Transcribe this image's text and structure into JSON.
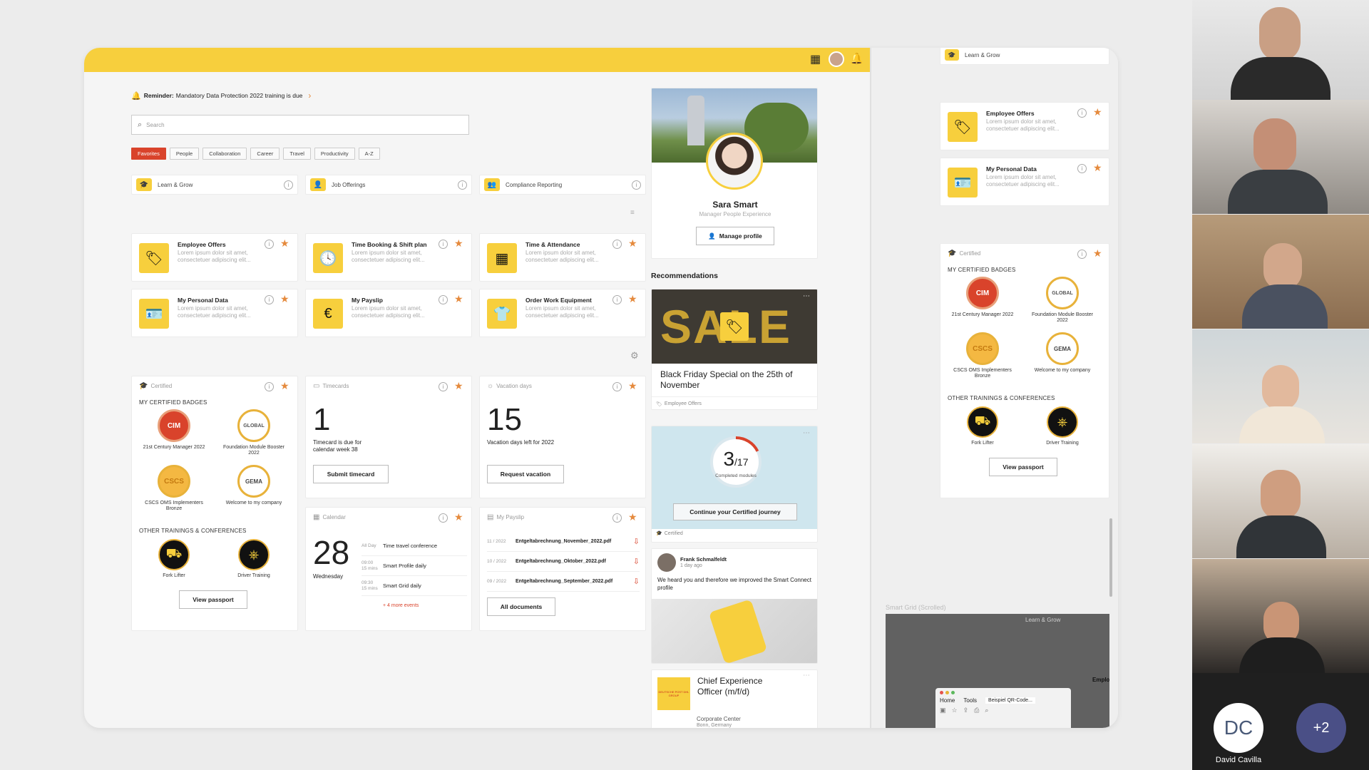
{
  "topbar": {
    "grid_icon": "grid-icon",
    "avatar": "avatar",
    "bell_icon": "bell-icon"
  },
  "reminder": {
    "label": "Reminder:",
    "text": "Mandatory Data Protection 2022 training is due"
  },
  "search": {
    "placeholder": "Search"
  },
  "tabs": [
    "Favorites",
    "People",
    "Collaboration",
    "Career",
    "Travel",
    "Productivity",
    "A-Z"
  ],
  "quicklinks": [
    "Learn & Grow",
    "Job Offerings",
    "Compliance Reporting"
  ],
  "apps": [
    {
      "title": "Employee Offers",
      "desc": "Lorem ipsum dolor sit amet, consectetuer adipiscing elit...",
      "icon": "tag-icon"
    },
    {
      "title": "Time Booking & Shift plan",
      "desc": "Lorem ipsum dolor sit amet, consectetuer adipiscing elit...",
      "icon": "clock-icon"
    },
    {
      "title": "Time & Attendance",
      "desc": "Lorem ipsum dolor sit amet, consectetuer adipiscing elit...",
      "icon": "calendar-grid-icon"
    },
    {
      "title": "My Personal Data",
      "desc": "Lorem ipsum dolor sit amet, consectetuer adipiscing elit...",
      "icon": "id-card-icon"
    },
    {
      "title": "My Payslip",
      "desc": "Lorem ipsum dolor sit amet, consectetuer adipiscing elit...",
      "icon": "payslip-icon"
    },
    {
      "title": "Order Work Equipment",
      "desc": "Lorem ipsum dolor sit amet, consectetuer adipiscing elit...",
      "icon": "shirt-icon"
    }
  ],
  "certified": {
    "header": "Certified",
    "badges_title": "MY CERTIFIED BADGES",
    "badges": [
      {
        "label": "21st Century Manager 2022",
        "mark": "CIM"
      },
      {
        "label": "Foundation Module Booster 2022",
        "mark": "GLOBAL"
      },
      {
        "label": "CSCS OMS Implementers Bronze",
        "mark": "CSCS"
      },
      {
        "label": "Welcome to my company",
        "mark": "GEMA"
      }
    ],
    "other_title": "OTHER TRAININGS & CONFERENCES",
    "other": [
      {
        "label": "Fork Lifter"
      },
      {
        "label": "Driver Training"
      }
    ],
    "button": "View passport"
  },
  "timecards": {
    "header": "Timecards",
    "number": "1",
    "text": "Timecard is due for calendar week 38",
    "button": "Submit timecard"
  },
  "vacation": {
    "header": "Vacation days",
    "number": "15",
    "text": "Vacation days left for 2022",
    "button": "Request vacation"
  },
  "calendar": {
    "header": "Calendar",
    "day": "28",
    "weekday": "Wednesday",
    "events": [
      {
        "time": "All Day",
        "dur": "",
        "title": "Time travel conference"
      },
      {
        "time": "09:00",
        "dur": "15 mins",
        "title": "Smart Profile daily"
      },
      {
        "time": "09:30",
        "dur": "15 mins",
        "title": "Smart Grid daily"
      }
    ],
    "more": "+ 4 more events"
  },
  "payslip": {
    "header": "My Payslip",
    "items": [
      {
        "date": "11 / 2022",
        "file": "Entgeltabrechnung_November_2022.pdf"
      },
      {
        "date": "10 / 2022",
        "file": "Entgeltabrechnung_Oktober_2022.pdf"
      },
      {
        "date": "09 / 2022",
        "file": "Entgeltabrechnung_September_2022.pdf"
      }
    ],
    "button": "All documents"
  },
  "profile": {
    "name": "Sara Smart",
    "role": "Manager People Experience",
    "button": "Manage profile"
  },
  "recommendations": {
    "title": "Recommendations",
    "sale": {
      "title": "Black Friday Special on the 25th of November",
      "tag": "Employee Offers",
      "image_text": "SALE"
    },
    "progress": {
      "done": "3",
      "total": "/17",
      "label": "Completed modules",
      "value": 0.176,
      "button": "Continue your Certified journey",
      "tag": "Certified"
    },
    "post": {
      "author": "Frank Schmalfeldt",
      "time": "1 day ago",
      "text": "We heard you and therefore we improved the Smart Connect profile"
    },
    "job": {
      "title": "Chief Experience Officer (m/f/d)",
      "place": "Corporate Center",
      "city": "Bonn, Germany",
      "logo_text": "DEUTSCHE POST DHL GROUP"
    }
  },
  "right": {
    "learn": "Learn & Grow",
    "apps": [
      {
        "title": "Employee Offers",
        "desc": "Lorem ipsum dolor sit amet, consectetuer adipiscing elit..."
      },
      {
        "title": "My Personal Data",
        "desc": "Lorem ipsum dolor sit amet, consectetuer adipiscing elit..."
      }
    ],
    "grid_caption": "Smart Grid (Scrolled)",
    "mini_learn": "Learn & Grow",
    "mini_emp": "Emplo",
    "browser": {
      "home": "Home",
      "tools": "Tools",
      "tab": "Beispiel QR-Code..."
    }
  },
  "participants": {
    "dc_initials": "DC",
    "dc_name": "David Cavilla",
    "more": "+2"
  },
  "colors": {
    "accent": "#f7cf3d",
    "star": "#e58a3d",
    "tab_active": "#d9432b"
  }
}
